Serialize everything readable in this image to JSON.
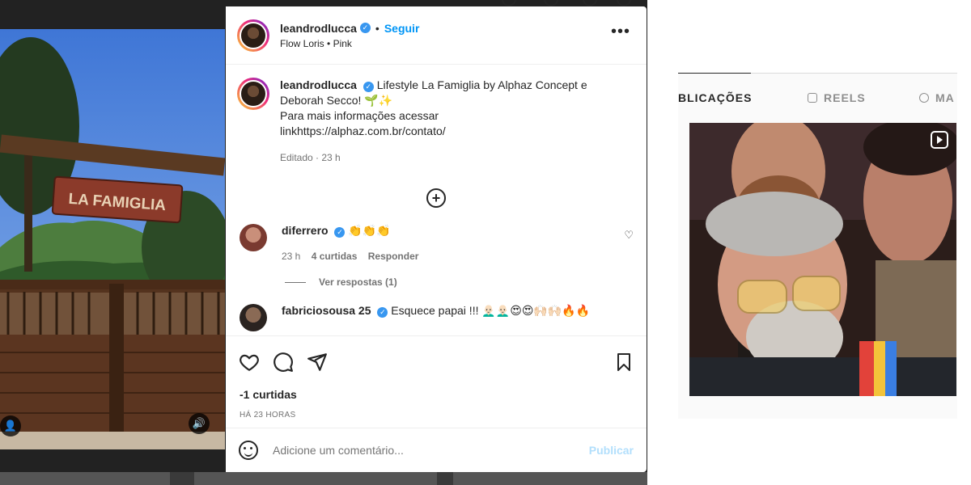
{
  "post": {
    "username": "leandrodlucca",
    "follow_label": "Seguir",
    "audio": "Flow Loris",
    "audio_separator": "•",
    "audio_artist": "Pink",
    "caption_text": "Lifestyle La Famiglia by Alphaz Concept e Deborah Secco! 🌱✨",
    "caption_line2": "Para mais informações acessar",
    "caption_line3": "linkhttps://alphaz.com.br/contato/",
    "caption_meta": "Editado · 23 h",
    "sign_text": "LA FAMIGLIA",
    "likes": "-1 curtidas",
    "timestamp": "HÁ 23 HORAS"
  },
  "comments": [
    {
      "username": "diferrero",
      "text": "👏👏👏",
      "time": "23 h",
      "likes": "4 curtidas",
      "reply_label": "Responder",
      "view_replies": "Ver respostas (1)"
    },
    {
      "username": "fabriciosousa 25",
      "text": "Esquece papai !!! 👨🏻‍🦲👨🏻‍🦲😍😍🙌🏻🙌🏻🔥🔥"
    }
  ],
  "composer": {
    "placeholder": "Adicione um comentário...",
    "publish_label": "Publicar"
  },
  "profile_tabs": [
    {
      "label": "BLICAÇÕES",
      "icon": ""
    },
    {
      "label": "REELS",
      "icon": "reels-icon"
    },
    {
      "label": "MA",
      "icon": "tagged-icon"
    }
  ],
  "colors": {
    "accent": "#0095f6",
    "publish_disabled": "#b2dffc",
    "verified": "#3897f0"
  }
}
